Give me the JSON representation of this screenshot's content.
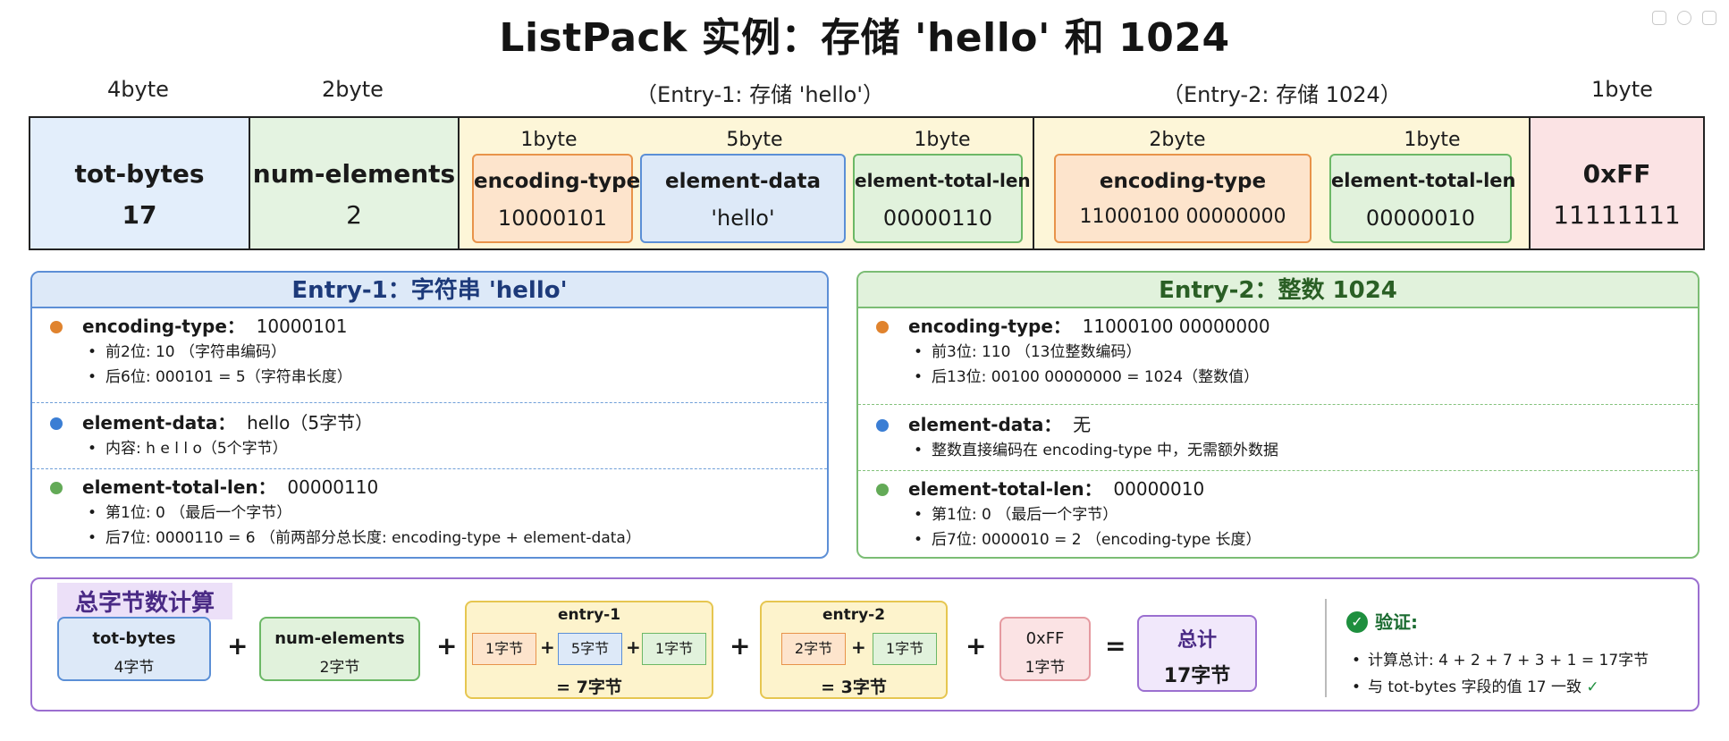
{
  "title": "ListPack 实例：存储 'hello' 和 1024",
  "top_labels": {
    "tot": "4byte",
    "num": "2byte",
    "entry1": "（Entry-1: 存储 'hello'）",
    "entry2": "（Entry-2: 存储  1024）",
    "end": "1byte"
  },
  "layout": {
    "tot_bytes": {
      "name": "tot-bytes",
      "value": "17"
    },
    "num_elements": {
      "name": "num-elements",
      "value": "2"
    },
    "entry1": {
      "fields": [
        {
          "size": "1byte",
          "name": "encoding-type",
          "value": "10000101"
        },
        {
          "size": "5byte",
          "name": "element-data",
          "value": "'hello'"
        },
        {
          "size": "1byte",
          "name": "element-total-len",
          "value": "00000110"
        }
      ]
    },
    "entry2": {
      "fields": [
        {
          "size": "2byte",
          "name": "encoding-type",
          "value": "11000100  00000000"
        },
        {
          "size": "1byte",
          "name": "element-total-len",
          "value": "00000010"
        }
      ]
    },
    "end": {
      "name": "0xFF",
      "value": "11111111"
    }
  },
  "panel1": {
    "title": "Entry-1：字符串 'hello'",
    "sections": [
      {
        "key": "encoding-type：",
        "value": "10000101",
        "bullets": [
          "前2位:  10  （字符串编码）",
          "后6位:  000101 = 5（字符串长度）"
        ]
      },
      {
        "key": "element-data：",
        "value": "hello（5字节）",
        "bullets": [
          "内容:  h e l l o（5个字节）"
        ]
      },
      {
        "key": "element-total-len：",
        "value": "00000110",
        "bullets": [
          "第1位:  0  （最后一个字节）",
          "后7位:  0000110 = 6  （前两部分总长度:  encoding-type + element-data）"
        ]
      }
    ]
  },
  "panel2": {
    "title": "Entry-2：整数 1024",
    "sections": [
      {
        "key": "encoding-type：",
        "value": "11000100  00000000",
        "bullets": [
          "前3位:  110  （13位整数编码）",
          "后13位:  00100 00000000 = 1024（整数值）"
        ]
      },
      {
        "key": "element-data：",
        "value": "无",
        "bullets": [
          "整数直接编码在 encoding-type 中，无需额外数据"
        ]
      },
      {
        "key": "element-total-len：",
        "value": "00000010",
        "bullets": [
          "第1位:  0  （最后一个字节）",
          "后7位:  0000010 = 2  （encoding-type 长度）"
        ]
      }
    ]
  },
  "total": {
    "tag": "总字节数计算",
    "tot": {
      "name": "tot-bytes",
      "bytes": "4字节"
    },
    "num": {
      "name": "num-elements",
      "bytes": "2字节"
    },
    "entry1": {
      "name": "entry-1",
      "parts": [
        "1字节",
        "5字节",
        "1字节"
      ],
      "sum": "=  7字节"
    },
    "entry2": {
      "name": "entry-2",
      "parts": [
        "2字节",
        "1字节"
      ],
      "sum": "=  3字节"
    },
    "end": {
      "name": "0xFF",
      "bytes": "1字节"
    },
    "plus": "+",
    "equals": "=",
    "result": {
      "label": "总计",
      "value": "17字节"
    },
    "verify": {
      "title": "验证:",
      "lines": [
        "计算总计:  4  +  2  +  7  +  3  +  1  =  17字节",
        "与  tot-bytes 字段的值  17  一致"
      ],
      "check": "✓"
    }
  }
}
